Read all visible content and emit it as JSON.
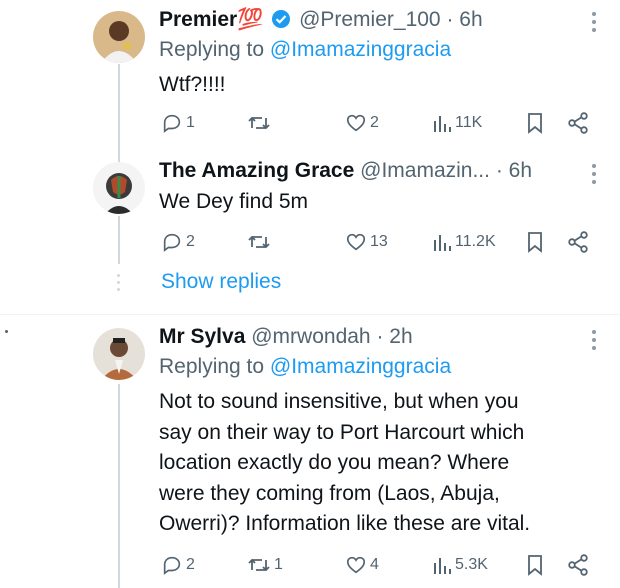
{
  "tweets": [
    {
      "display_name": "Premier💯",
      "handle": "@Premier_100",
      "time": "· 6h",
      "verified": true,
      "replying_label": "Replying to",
      "replying_to": "@Imamazinggracia",
      "text": "Wtf?!!!!",
      "stats": {
        "replies": "1",
        "retweets": "",
        "likes": "2",
        "views": "11K"
      }
    },
    {
      "display_name": "The Amazing Grace",
      "handle": "@Imamazin...",
      "time": "· 6h",
      "verified": false,
      "text": "We Dey find 5m",
      "stats": {
        "replies": "2",
        "retweets": "",
        "likes": "13",
        "views": "11.2K"
      }
    },
    {
      "display_name": "Mr Sylva",
      "handle": "@mrwondah",
      "time": "· 2h",
      "verified": false,
      "replying_label": "Replying to",
      "replying_to": "@Imamazinggracia",
      "text_lines": [
        "Not to sound insensitive,  but when you",
        "say on their way to Port Harcourt which",
        "location exactly do you mean? Where",
        "were they  coming from (Laos, Abuja,",
        "Owerri)? Information like these are vital."
      ],
      "stats": {
        "replies": "2",
        "retweets": "1",
        "likes": "4",
        "views": "5.3K"
      }
    }
  ],
  "show_replies_label": "Show replies",
  "colors": {
    "link": "#1d9bf0",
    "muted": "#536471",
    "text": "#0f1419",
    "line": "#cfd9de"
  }
}
